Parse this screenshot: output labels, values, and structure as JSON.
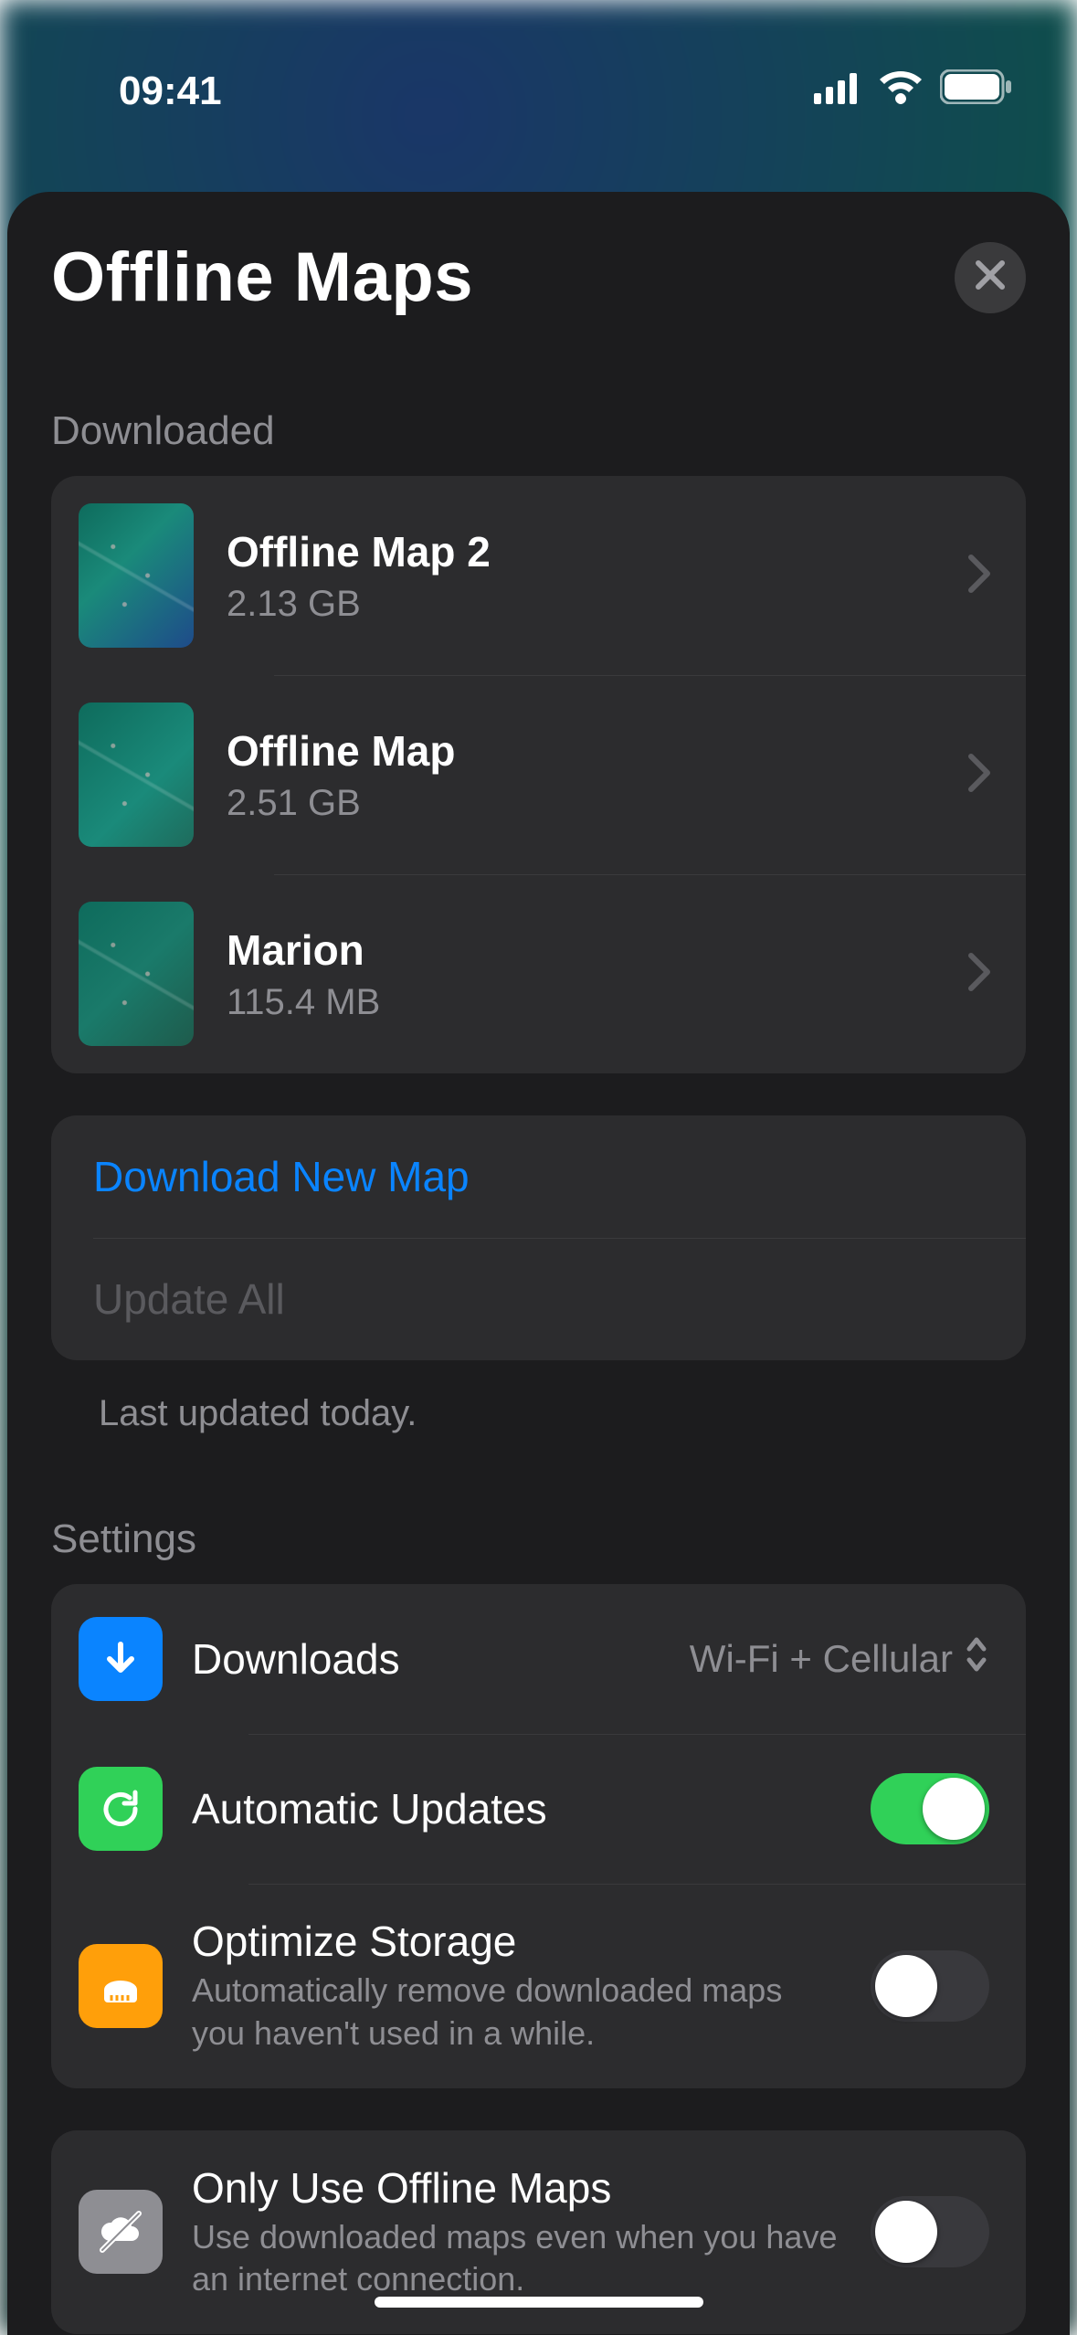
{
  "status": {
    "time": "09:41"
  },
  "sheet": {
    "title": "Offline Maps",
    "downloaded_label": "Downloaded",
    "maps": [
      {
        "name": "Offline Map 2",
        "size": "2.13 GB"
      },
      {
        "name": "Offline Map",
        "size": "2.51 GB"
      },
      {
        "name": "Marion",
        "size": "115.4 MB"
      }
    ],
    "actions": {
      "download_new": "Download New Map",
      "update_all": "Update All",
      "last_updated": "Last updated today."
    },
    "settings_label": "Settings",
    "settings": {
      "downloads": {
        "label": "Downloads",
        "value": "Wi-Fi + Cellular"
      },
      "auto_updates": {
        "label": "Automatic Updates",
        "on": true
      },
      "optimize": {
        "label": "Optimize Storage",
        "desc": "Automatically remove downloaded maps you haven't used in a while.",
        "on": false
      },
      "only_offline": {
        "label": "Only Use Offline Maps",
        "desc": "Use downloaded maps even when you have an internet connection.",
        "on": false
      }
    }
  }
}
